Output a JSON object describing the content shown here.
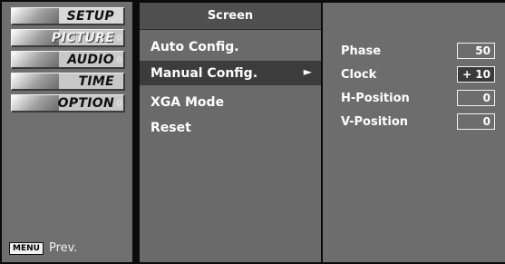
{
  "sidebar": {
    "tabs": [
      {
        "label": "SETUP",
        "icon": "setup-icon"
      },
      {
        "label": "PICTURE",
        "icon": "picture-icon",
        "mini": "0"
      },
      {
        "label": "AUDIO",
        "icon": "audio-icon",
        "mini": "0"
      },
      {
        "label": "TIME",
        "icon": "time-icon"
      },
      {
        "label": "OPTION",
        "icon": "option-icon",
        "mini": "0"
      }
    ],
    "menu_badge": "MENU",
    "prev_label": "Prev."
  },
  "menu": {
    "title": "Screen",
    "items": [
      {
        "label": "Auto Config."
      },
      {
        "label": "Manual Config.",
        "arrow": "►"
      },
      {
        "label": "XGA Mode"
      },
      {
        "label": "Reset"
      }
    ]
  },
  "values": {
    "rows": [
      {
        "name": "Phase",
        "value": "50"
      },
      {
        "name": "Clock",
        "value": "+ 10"
      },
      {
        "name": "H-Position",
        "value": "0"
      },
      {
        "name": "V-Position",
        "value": "0"
      }
    ]
  }
}
